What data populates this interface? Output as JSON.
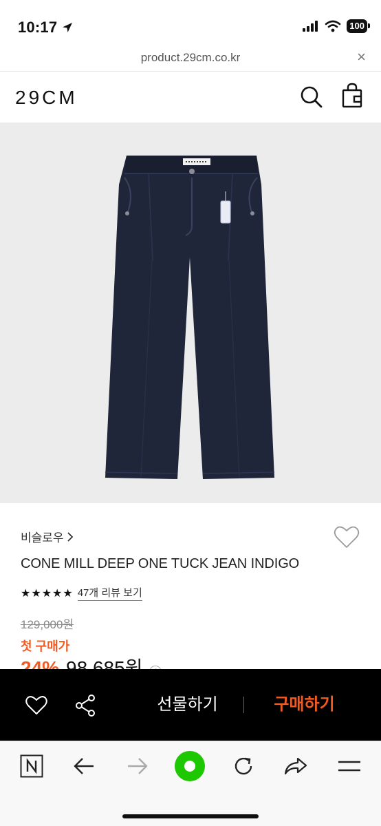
{
  "status_bar": {
    "time": "10:17",
    "battery": "100"
  },
  "browser": {
    "url": "product.29cm.co.kr",
    "close_glyph": "×"
  },
  "site": {
    "logo": "29CM"
  },
  "product": {
    "brand": "비슬로우",
    "name": "CONE MILL DEEP ONE TUCK JEAN INDIGO",
    "stars": "★★★★★",
    "rating": 5,
    "review_link": "47개 리뷰 보기",
    "original_price": "129,000원",
    "first_purchase_label": "첫 구매가",
    "discount": "24%",
    "sale_price": "98,685원",
    "help_glyph": "?"
  },
  "actions": {
    "gift_label": "선물하기",
    "buy_label": "구매하기"
  },
  "colors": {
    "accent": "#f15a22",
    "buy_bar": "#000000",
    "image_bg": "#ececec",
    "denim": "#20263a",
    "toolbar_green": "#1ec800"
  },
  "icons": [
    "location-arrow-icon",
    "signal-icon",
    "wifi-icon",
    "close-icon",
    "search-icon",
    "shopping-bag-icon",
    "heart-icon",
    "share-icon",
    "naver-n-icon",
    "back-arrow-icon",
    "forward-arrow-icon",
    "green-dot-icon",
    "refresh-icon",
    "share-forward-icon",
    "menu-icon"
  ]
}
